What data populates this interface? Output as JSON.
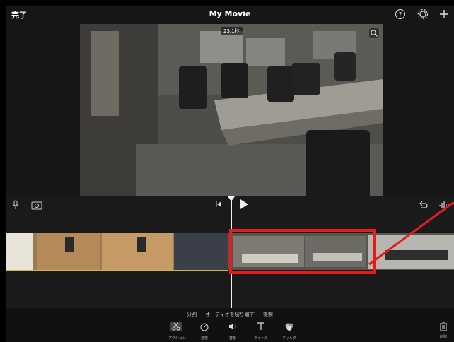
{
  "header": {
    "done_label": "完了",
    "title": "My Movie"
  },
  "preview": {
    "timestamp": "23.1秒"
  },
  "edit_panel": {
    "actions": [
      "分割",
      "オーディオを切り離す",
      "複製"
    ],
    "tools": [
      {
        "label": "アクション",
        "icon": "scissors-icon",
        "active": true
      },
      {
        "label": "速度",
        "icon": "speed-icon",
        "active": false
      },
      {
        "label": "音量",
        "icon": "volume-icon",
        "active": false
      },
      {
        "label": "タイトル",
        "icon": "title-icon",
        "active": false
      },
      {
        "label": "フィルタ",
        "icon": "filter-icon",
        "active": false
      }
    ],
    "delete_label": "削除"
  },
  "colors": {
    "annotation": "#e61b1b",
    "clip_underline": "#d6b646",
    "playhead": "#f2f2f2"
  }
}
